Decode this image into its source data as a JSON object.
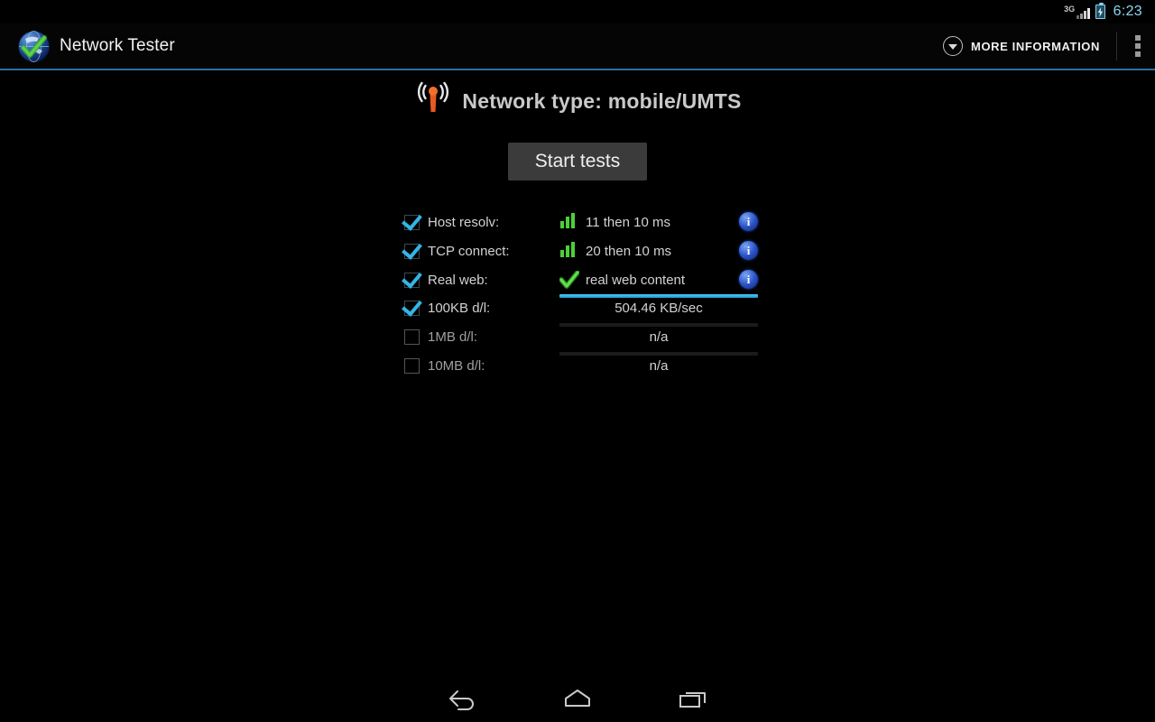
{
  "status_bar": {
    "network_label": "3G",
    "clock": "6:23",
    "signal_icon": "signal-bars-icon",
    "battery_icon": "battery-charging-icon"
  },
  "action_bar": {
    "app_icon": "globe-check-icon",
    "title": "Network Tester",
    "more_information_label": "MORE INFORMATION",
    "more_information_icon": "chevron-down-circle-icon",
    "overflow_icon": "overflow-menu-icon"
  },
  "main": {
    "network_type_icon": "antenna-broadcast-icon",
    "network_type_text": "Network type: mobile/UMTS",
    "start_button_label": "Start tests",
    "tests": [
      {
        "label": "Host resolv:",
        "checked": true,
        "result_icon": "signal-bars-green-icon",
        "result_text": "11 then 10 ms",
        "info_label": "i"
      },
      {
        "label": "TCP connect:",
        "checked": true,
        "result_icon": "signal-bars-green-icon",
        "result_text": "20 then 10 ms",
        "info_label": "i"
      },
      {
        "label": "Real web:",
        "checked": true,
        "result_icon": "check-green-icon",
        "result_text": "real web content",
        "info_label": "i"
      }
    ],
    "downloads": [
      {
        "label": "100KB d/l:",
        "checked": true,
        "progress": 100,
        "result_text": "504.46 KB/sec"
      },
      {
        "label": "1MB d/l:",
        "checked": false,
        "progress": 0,
        "result_text": "n/a"
      },
      {
        "label": "10MB d/l:",
        "checked": false,
        "progress": 0,
        "result_text": "n/a"
      }
    ]
  },
  "nav_bar": {
    "back_icon": "back-arrow-icon",
    "home_icon": "home-icon",
    "recents_icon": "recent-apps-icon"
  },
  "colors": {
    "accent_blue": "#33b5e5",
    "clock_blue": "#8fd4ef",
    "success_green": "#4cd137",
    "antenna_orange": "#e8591f",
    "action_bar_underline": "#2b6ea8"
  }
}
